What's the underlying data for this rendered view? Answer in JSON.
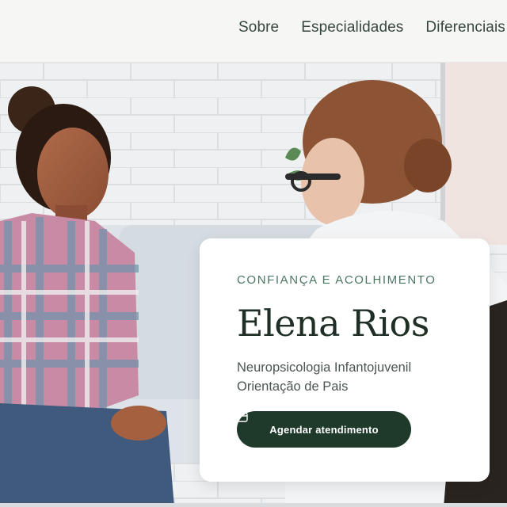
{
  "nav": {
    "items": [
      "Sobre",
      "Especialidades",
      "Diferenciais"
    ]
  },
  "hero": {
    "eyebrow": "CONFIANÇA E ACOLHIMENTO",
    "name": "Elena Rios",
    "subtitle_lines": [
      "Neuropsicologia Infantojuvenil",
      "Orientação de Pais"
    ],
    "cta_label": "Agendar atendimento",
    "cta_icon": "calendar-icon"
  },
  "colors": {
    "accent": "#4b7762",
    "button": "#1f3a2b",
    "heading": "#1f2f25"
  }
}
